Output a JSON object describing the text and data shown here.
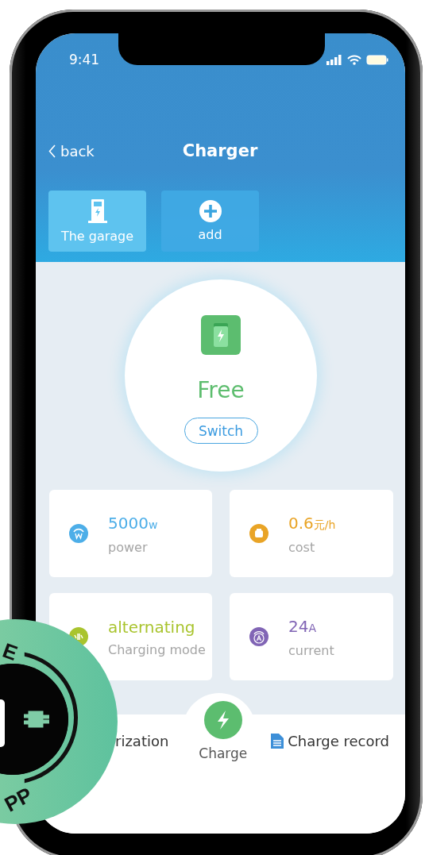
{
  "status_bar": {
    "time": "9:41"
  },
  "nav": {
    "back": "back",
    "title": "Charger"
  },
  "tabs": [
    {
      "label": "The garage",
      "kind": "station",
      "selected": true
    },
    {
      "label": "add",
      "kind": "add",
      "selected": false
    }
  ],
  "status": {
    "text": "Free",
    "button": "Switch"
  },
  "cards": [
    {
      "kind": "power",
      "value": "5000",
      "unit": "w",
      "label": "power",
      "color": "#4daee8"
    },
    {
      "kind": "cost",
      "value": "0.6",
      "unit": "元/h",
      "label": "cost",
      "color": "#e9a426"
    },
    {
      "kind": "mode",
      "value": "alternating",
      "label": "Charging mode",
      "color": "#a9c42e"
    },
    {
      "kind": "current",
      "value": "24",
      "unit": "A",
      "label": "current",
      "color": "#8165b5"
    }
  ],
  "bottom_bar": {
    "left": "rization",
    "center": "Charge",
    "right": "Charge record"
  },
  "badge": {
    "texts": [
      "E",
      "PP"
    ]
  }
}
